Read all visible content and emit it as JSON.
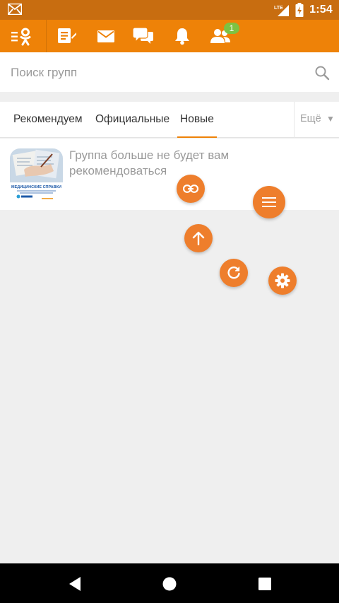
{
  "status_bar": {
    "time": "1:54",
    "network": "LTE"
  },
  "toolbar": {
    "icons": [
      "ok-logo-menu-icon",
      "feed-icon",
      "mail-icon",
      "chat-icon",
      "bell-icon",
      "friends-icon"
    ],
    "friends_badge": "1"
  },
  "search": {
    "placeholder": "Поиск групп"
  },
  "tabs": [
    {
      "label": "Рекомендуем",
      "active": false
    },
    {
      "label": "Официальные",
      "active": false
    },
    {
      "label": "Новые",
      "active": true
    }
  ],
  "tabs_more_label": "Ещё",
  "group_card": {
    "message": "Группа больше не будет вам рекомендоваться",
    "avatar_caption": "МЕДИЦИНСКИЕ СПРАВКИ"
  },
  "floating_buttons": [
    "link-icon",
    "menu-icon",
    "arrow-up-icon",
    "refresh-icon",
    "settings-icon"
  ],
  "colors": {
    "accent": "#ee8208",
    "status_bar": "#c86d10",
    "fab": "#ee7e2c",
    "badge": "#7dc242"
  }
}
